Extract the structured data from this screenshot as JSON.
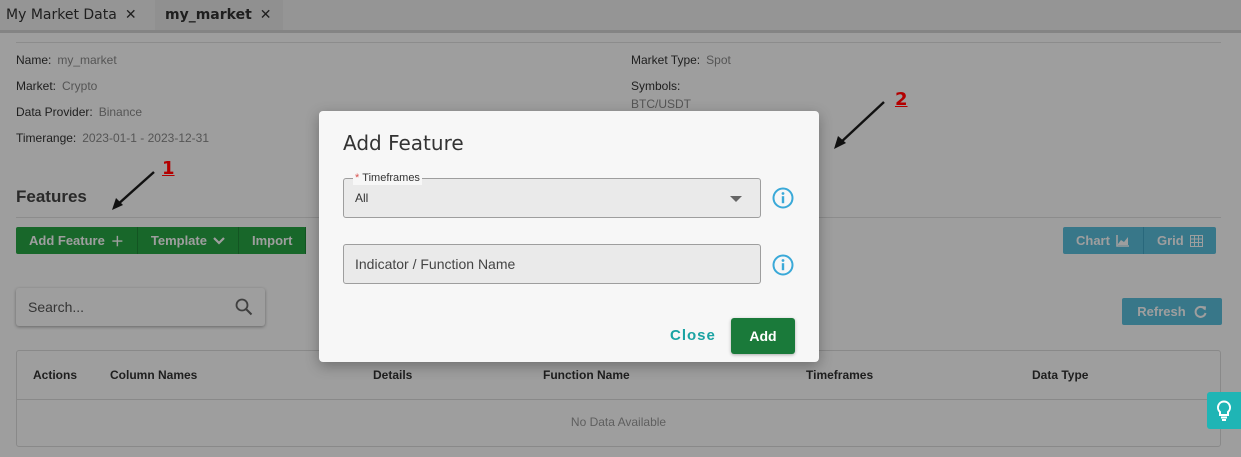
{
  "tabs": [
    {
      "label": "My Market Data",
      "close": "✕"
    },
    {
      "label": "my_market",
      "close": "✕"
    }
  ],
  "info": {
    "name_label": "Name:",
    "name_value": "my_market",
    "market_label": "Market:",
    "market_value": "Crypto",
    "provider_label": "Data Provider:",
    "provider_value": "Binance",
    "timerange_label": "Timerange:",
    "timerange_value": "2023-01-1 - 2023-12-31",
    "market_type_label": "Market Type:",
    "market_type_value": "Spot",
    "symbols_label": "Symbols:",
    "symbols_value": "BTC/USDT"
  },
  "features": {
    "title": "Features",
    "add_feature_label": "Add Feature",
    "template_label": "Template",
    "import_label": "Import",
    "chart_label": "Chart",
    "grid_label": "Grid",
    "search_placeholder": "Search...",
    "refresh_label": "Refresh"
  },
  "table": {
    "columns": [
      "Actions",
      "Column Names",
      "Details",
      "Function Name",
      "Timeframes",
      "Data Type"
    ],
    "empty_text": "No Data Available"
  },
  "annotations": [
    "1",
    "2"
  ],
  "modal": {
    "title": "Add Feature",
    "timeframes_label": "Timeframes",
    "timeframes_required": "*",
    "timeframes_value": "All",
    "indicator_placeholder": "Indicator / Function Name",
    "close_label": "Close",
    "add_label": "Add"
  },
  "colors": {
    "green": "#28a745",
    "teal": "#5bc0de",
    "add_button": "#1a7a3a",
    "annotation": "#b30000"
  },
  "icons": [
    "close-icon",
    "plus-icon",
    "chevron-down-icon",
    "chart-icon",
    "grid-icon",
    "search-icon",
    "refresh-icon",
    "info-icon",
    "lightbulb-icon",
    "caret-down-icon"
  ]
}
